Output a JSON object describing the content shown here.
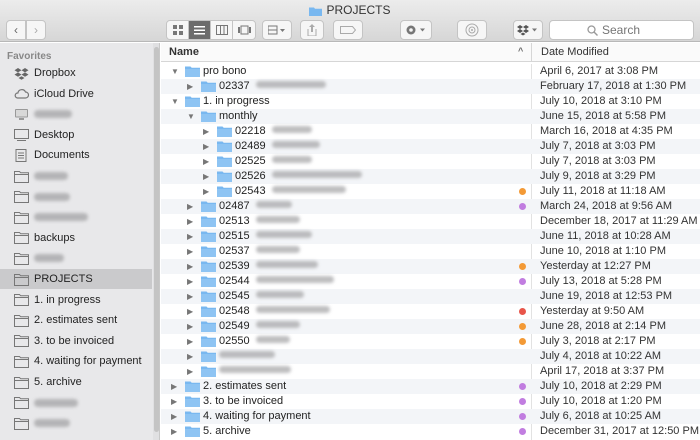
{
  "window": {
    "title": "PROJECTS"
  },
  "toolbar": {
    "back_glyph": "‹",
    "forward_glyph": "›",
    "search_placeholder": "Search"
  },
  "sidebar": {
    "heading": "Favorites",
    "items": [
      {
        "label": "Dropbox",
        "icon": "dropbox-icon"
      },
      {
        "label": "iCloud Drive",
        "icon": "cloud-icon"
      },
      {
        "label": "",
        "icon": "computer-icon"
      },
      {
        "label": "Desktop",
        "icon": "desktop-icon"
      },
      {
        "label": "Documents",
        "icon": "documents-icon"
      },
      {
        "label": "",
        "icon": "folder-icon"
      },
      {
        "label": "",
        "icon": "folder-icon"
      },
      {
        "label": "",
        "icon": "folder-icon"
      },
      {
        "label": "backups",
        "icon": "folder-icon"
      },
      {
        "label": "",
        "icon": "folder-icon"
      },
      {
        "label": "PROJECTS",
        "icon": "folder-icon"
      },
      {
        "label": "1. in progress",
        "icon": "folder-icon"
      },
      {
        "label": "2. estimates sent",
        "icon": "folder-icon"
      },
      {
        "label": "3. to be invoiced",
        "icon": "folder-icon"
      },
      {
        "label": "4. waiting for payment",
        "icon": "folder-icon"
      },
      {
        "label": "5. archive",
        "icon": "folder-icon"
      },
      {
        "label": "",
        "icon": "folder-icon"
      },
      {
        "label": "",
        "icon": "folder-icon"
      }
    ]
  },
  "columns": {
    "name": "Name",
    "date": "Date Modified"
  },
  "colors": {
    "orange": "#f39a36",
    "purple": "#c17de0",
    "red": "#e8554a",
    "folder": "#79b8f0",
    "selected": "#cacacc"
  },
  "rows": [
    {
      "name": "pro bono",
      "date": "April 6, 2017 at 3:08 PM",
      "level": 0,
      "expanded": true,
      "tag": ""
    },
    {
      "name": "02337",
      "date": "February 17, 2018 at 1:30 PM",
      "level": 1,
      "expanded": false,
      "tag": ""
    },
    {
      "name": "1. in progress",
      "date": "July 10, 2018 at 3:10 PM",
      "level": 0,
      "expanded": true,
      "tag": ""
    },
    {
      "name": "monthly",
      "date": "June 15, 2018 at 5:58 PM",
      "level": 1,
      "expanded": true,
      "tag": ""
    },
    {
      "name": "02218",
      "date": "March 16, 2018 at 4:35 PM",
      "level": 2,
      "expanded": false,
      "tag": ""
    },
    {
      "name": "02489",
      "date": "July 7, 2018 at 3:03 PM",
      "level": 2,
      "expanded": false,
      "tag": ""
    },
    {
      "name": "02525",
      "date": "July 7, 2018 at 3:03 PM",
      "level": 2,
      "expanded": false,
      "tag": ""
    },
    {
      "name": "02526",
      "date": "July 9, 2018 at 3:29 PM",
      "level": 2,
      "expanded": false,
      "tag": ""
    },
    {
      "name": "02543",
      "date": "July 11, 2018 at 11:18 AM",
      "level": 2,
      "expanded": false,
      "tag": "orange"
    },
    {
      "name": "02487",
      "date": "March 24, 2018 at 9:56 AM",
      "level": 1,
      "expanded": false,
      "tag": "purple"
    },
    {
      "name": "02513",
      "date": "December 18, 2017 at 11:29 AM",
      "level": 1,
      "expanded": false,
      "tag": ""
    },
    {
      "name": "02515",
      "date": "June 11, 2018 at 10:28 AM",
      "level": 1,
      "expanded": false,
      "tag": ""
    },
    {
      "name": "02537",
      "date": "June 10, 2018 at 1:10 PM",
      "level": 1,
      "expanded": false,
      "tag": ""
    },
    {
      "name": "02539",
      "date": "Yesterday at 12:27 PM",
      "level": 1,
      "expanded": false,
      "tag": "orange"
    },
    {
      "name": "02544",
      "date": "July 13, 2018 at 5:28 PM",
      "level": 1,
      "expanded": false,
      "tag": "purple"
    },
    {
      "name": "02545",
      "date": "June 19, 2018 at 12:53 PM",
      "level": 1,
      "expanded": false,
      "tag": ""
    },
    {
      "name": "02548",
      "date": "Yesterday at 9:50 AM",
      "level": 1,
      "expanded": false,
      "tag": "red"
    },
    {
      "name": "02549",
      "date": "June 28, 2018 at 2:14 PM",
      "level": 1,
      "expanded": false,
      "tag": "orange"
    },
    {
      "name": "02550",
      "date": "July 3, 2018 at 2:17 PM",
      "level": 1,
      "expanded": false,
      "tag": "orange"
    },
    {
      "name": "",
      "date": "July 4, 2018 at 10:22 AM",
      "level": 1,
      "expanded": false,
      "tag": ""
    },
    {
      "name": "",
      "date": "April 17, 2018 at 3:37 PM",
      "level": 1,
      "expanded": false,
      "tag": ""
    },
    {
      "name": "2. estimates sent",
      "date": "July 10, 2018 at 2:29 PM",
      "level": 0,
      "expanded": false,
      "tag": "purple"
    },
    {
      "name": "3. to be invoiced",
      "date": "July 10, 2018 at 1:20 PM",
      "level": 0,
      "expanded": false,
      "tag": "purple"
    },
    {
      "name": "4. waiting for payment",
      "date": "July 6, 2018 at 10:25 AM",
      "level": 0,
      "expanded": false,
      "tag": "purple"
    },
    {
      "name": "5. archive",
      "date": "December 31, 2017 at 12:50 PM",
      "level": 0,
      "expanded": false,
      "tag": "purple"
    }
  ]
}
